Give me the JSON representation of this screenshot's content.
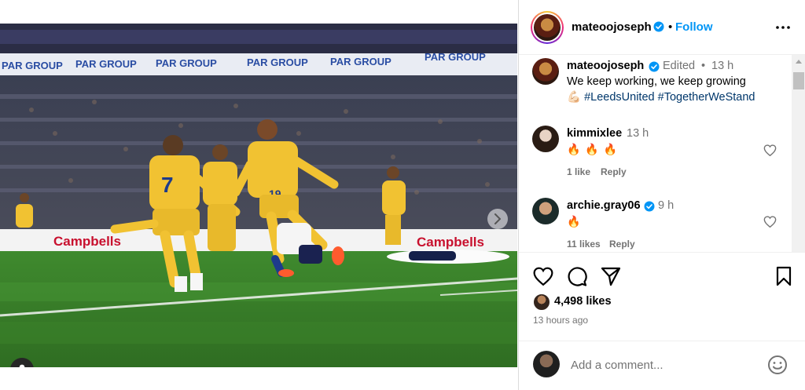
{
  "post": {
    "photo_sign_text": "PAR GROUP",
    "photo_board_text": "Campbells",
    "photo_jersey_numbers": [
      "7",
      "19"
    ],
    "carousel_dots": 4,
    "carousel_active": 0
  },
  "header": {
    "username": "mateoojoseph",
    "separator": "•",
    "follow_label": "Follow"
  },
  "caption": {
    "username": "mateoojoseph",
    "edited": "Edited",
    "dot": "•",
    "time": "13 h",
    "text_line": "We keep working, we keep growing",
    "emoji": "💪🏻",
    "hashtags": [
      "#LeedsUnited",
      "#TogetherWeStand"
    ]
  },
  "comments": [
    {
      "username": "kimmixlee",
      "verified": false,
      "time": "13 h",
      "text": "🔥🔥🔥",
      "likes_label": "1 like",
      "reply_label": "Reply"
    },
    {
      "username": "archie.gray06",
      "verified": true,
      "time": "9 h",
      "text": "🔥",
      "likes_label": "11 likes",
      "reply_label": "Reply"
    }
  ],
  "stats": {
    "likes": "4,498 likes",
    "posted": "13 hours ago"
  },
  "add_comment": {
    "placeholder": "Add a comment..."
  },
  "colors": {
    "accent": "#0095f6",
    "verified": "#0095f6",
    "hashtag": "#00376b",
    "muted": "#737373",
    "jersey": "#f1c232"
  },
  "icons": [
    "user-tag-icon",
    "chevron-right-icon",
    "verified-icon",
    "more-icon",
    "heart-icon",
    "comment-icon",
    "share-icon",
    "bookmark-icon",
    "emoji-icon"
  ]
}
